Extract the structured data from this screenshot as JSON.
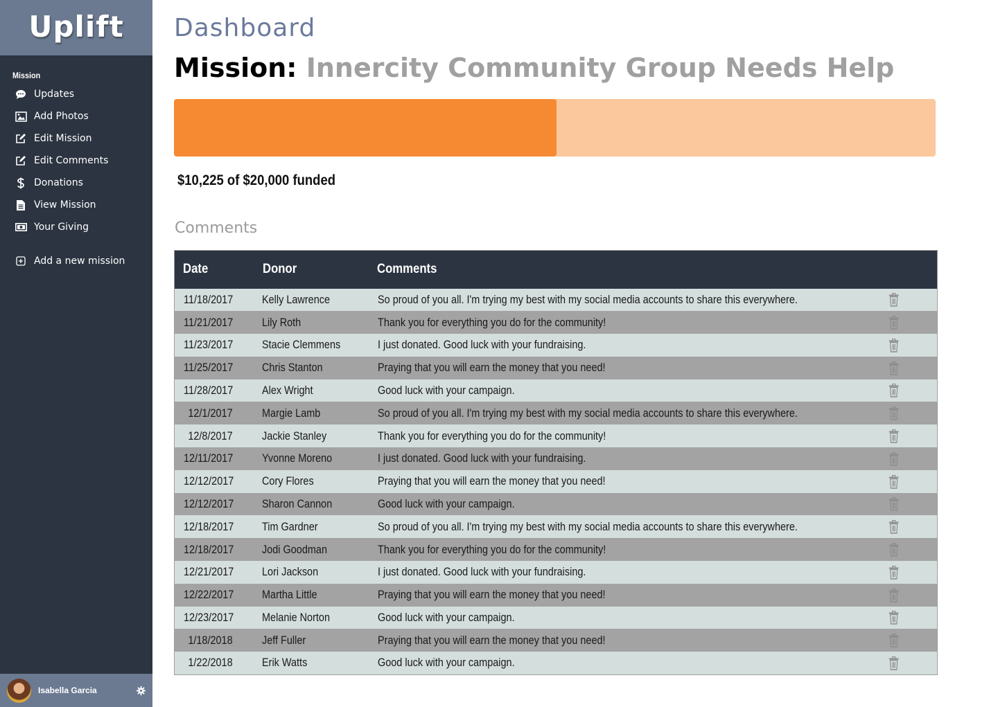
{
  "app": {
    "logo": "Uplift"
  },
  "sidebar": {
    "section_label": "Mission",
    "items": [
      {
        "label": "Updates",
        "icon": "chat-bubble-icon"
      },
      {
        "label": "Add Photos",
        "icon": "image-icon"
      },
      {
        "label": "Edit Mission",
        "icon": "edit-icon"
      },
      {
        "label": "Edit Comments",
        "icon": "edit-icon"
      },
      {
        "label": "Donations",
        "icon": "dollar-icon"
      },
      {
        "label": "View Mission",
        "icon": "document-icon"
      },
      {
        "label": "Your Giving",
        "icon": "money-icon"
      }
    ],
    "add_mission": {
      "label": "Add a new mission",
      "icon": "plus-square-icon"
    }
  },
  "user": {
    "name": "Isabella Garcia"
  },
  "page": {
    "title": "Dashboard",
    "mission_label": "Mission:",
    "mission_name": "Innercity Community Group Needs Help"
  },
  "funding": {
    "raised": 10225,
    "goal": 20000,
    "progress_fraction": 0.5026,
    "text": "$10,225 of $20,000 funded",
    "colors": {
      "fill": "#f68a33",
      "track": "#fbc79c"
    }
  },
  "comments": {
    "title": "Comments",
    "headers": {
      "date": "Date",
      "donor": "Donor",
      "comments": "Comments"
    },
    "rows": [
      {
        "date": "11/18/2017",
        "donor": "Kelly Lawrence",
        "comment": "So proud of you all. I'm trying my best with my social media accounts to share this everywhere."
      },
      {
        "date": "11/21/2017",
        "donor": "Lily Roth",
        "comment": "Thank you for everything you do for the community!"
      },
      {
        "date": "11/23/2017",
        "donor": "Stacie Clemmens",
        "comment": "I just donated. Good luck with your fundraising."
      },
      {
        "date": "11/25/2017",
        "donor": "Chris Stanton",
        "comment": "Praying that you will earn the money that you need!"
      },
      {
        "date": "11/28/2017",
        "donor": "Alex Wright",
        "comment": "Good luck with your campaign."
      },
      {
        "date": "12/1/2017",
        "donor": "Margie Lamb",
        "comment": "So proud of you all. I'm trying my best with my social media accounts to share this everywhere."
      },
      {
        "date": "12/8/2017",
        "donor": "Jackie Stanley",
        "comment": "Thank you for everything you do for the community!"
      },
      {
        "date": "12/11/2017",
        "donor": "Yvonne Moreno",
        "comment": "I just donated. Good luck with your fundraising."
      },
      {
        "date": "12/12/2017",
        "donor": "Cory Flores",
        "comment": "Praying that you will earn the money that you need!"
      },
      {
        "date": "12/12/2017",
        "donor": "Sharon Cannon",
        "comment": "Good luck with your campaign."
      },
      {
        "date": "12/18/2017",
        "donor": "Tim Gardner",
        "comment": "So proud of you all. I'm trying my best with my social media accounts to share this everywhere."
      },
      {
        "date": "12/18/2017",
        "donor": "Jodi Goodman",
        "comment": "Thank you for everything you do for the community!"
      },
      {
        "date": "12/21/2017",
        "donor": "Lori Jackson",
        "comment": "I just donated. Good luck with your fundraising."
      },
      {
        "date": "12/22/2017",
        "donor": "Martha Little",
        "comment": "Praying that you will earn the money that you need!"
      },
      {
        "date": "12/23/2017",
        "donor": "Melanie Norton",
        "comment": "Good luck with your campaign."
      },
      {
        "date": "1/18/2018",
        "donor": "Jeff Fuller",
        "comment": "Praying that you will earn the money that you need!"
      },
      {
        "date": "1/22/2018",
        "donor": "Erik Watts",
        "comment": "Good luck with your campaign."
      }
    ]
  },
  "colors": {
    "sidebar_bg": "#2c3441",
    "logo_bg": "#6b7a91",
    "row_light": "#d4dedd",
    "row_dark": "#a3a3a3"
  }
}
